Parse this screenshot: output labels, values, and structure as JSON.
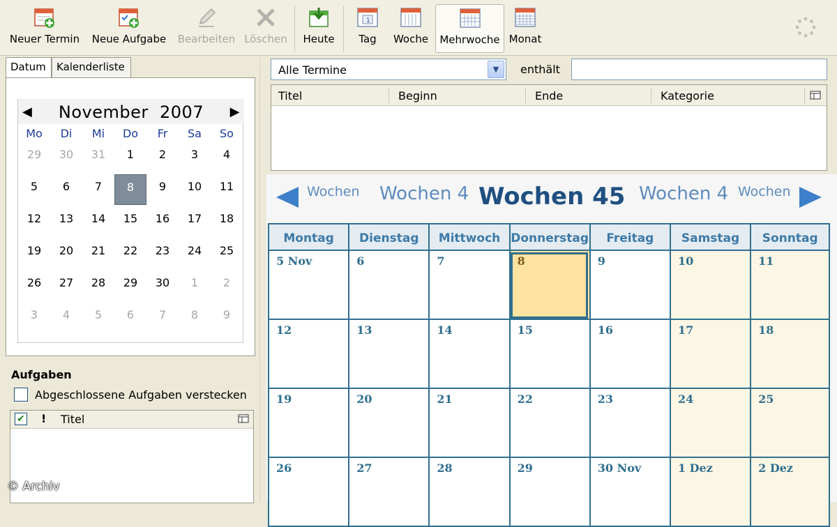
{
  "toolbar": {
    "new_event": "Neuer Termin",
    "new_task": "Neue Aufgabe",
    "edit": "Bearbeiten",
    "delete": "Löschen",
    "today": "Heute",
    "day": "Tag",
    "week": "Woche",
    "multiweek": "Mehrwoche",
    "month": "Monat"
  },
  "tabs": {
    "date": "Datum",
    "calendar_list": "Kalenderliste"
  },
  "minicalendar": {
    "month": "November",
    "year": "2007",
    "prev": "◀",
    "next": "▶",
    "weekdays": [
      "Mo",
      "Di",
      "Mi",
      "Do",
      "Fr",
      "Sa",
      "So"
    ],
    "weeks": [
      [
        "29",
        "30",
        "31",
        "1",
        "2",
        "3",
        "4"
      ],
      [
        "5",
        "6",
        "7",
        "8",
        "9",
        "10",
        "11"
      ],
      [
        "12",
        "13",
        "14",
        "15",
        "16",
        "17",
        "18"
      ],
      [
        "19",
        "20",
        "21",
        "22",
        "23",
        "24",
        "25"
      ],
      [
        "26",
        "27",
        "28",
        "29",
        "30",
        "1",
        "2"
      ],
      [
        "3",
        "4",
        "5",
        "6",
        "7",
        "8",
        "9"
      ]
    ]
  },
  "tasks": {
    "title": "Aufgaben",
    "hide_completed": "Abgeschlossene Aufgaben verstecken",
    "col_priority": "!",
    "col_title": "Titel"
  },
  "filter": {
    "selected": "Alle Termine",
    "contains_label": "enthält",
    "contains_value": ""
  },
  "event_list": {
    "columns": [
      "Titel",
      "Beginn",
      "Ende",
      "Kategorie"
    ]
  },
  "multiweek": {
    "far_prev": "Wochen",
    "near_prev": "Wochen 4",
    "current": "Wochen 45",
    "near_next": "Wochen 4",
    "far_next": "Wochen",
    "weekdays": [
      "Montag",
      "Dienstag",
      "Mittwoch",
      "Donnerstag",
      "Freitag",
      "Samstag",
      "Sonntag"
    ],
    "weeks": [
      [
        "5 Nov",
        "6",
        "7",
        "8",
        "9",
        "10",
        "11"
      ],
      [
        "12",
        "13",
        "14",
        "15",
        "16",
        "17",
        "18"
      ],
      [
        "19",
        "20",
        "21",
        "22",
        "23",
        "24",
        "25"
      ],
      [
        "26",
        "27",
        "28",
        "29",
        "30 Nov",
        "1 Dez",
        "2 Dez"
      ]
    ]
  },
  "watermark": "© Archiv",
  "colors": {
    "accent": "#2f6f8f",
    "today_highlight": "#fde3a0",
    "weekend": "#fcf6e4",
    "nav_arrow": "#3d7fc8"
  }
}
